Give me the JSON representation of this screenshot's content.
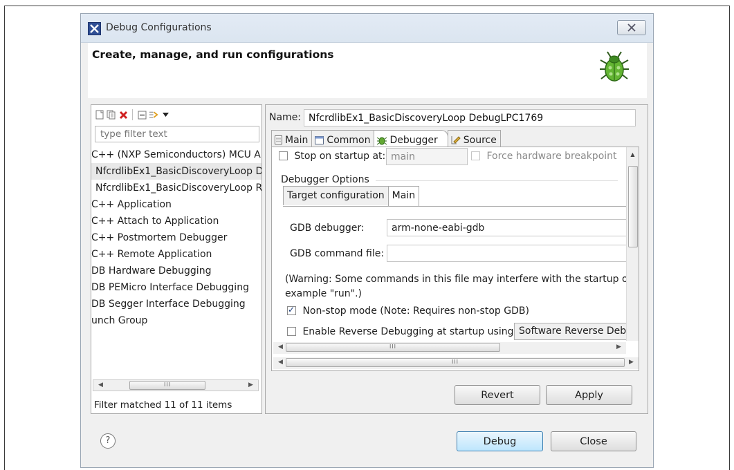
{
  "window": {
    "title": "Debug Configurations",
    "header_title": "Create, manage, and run configurations"
  },
  "left_panel": {
    "toolbar": [
      "new-config-icon",
      "duplicate-icon",
      "delete-icon",
      "collapse-all-icon",
      "filter-icon",
      "dropdown-icon"
    ],
    "filter_placeholder": "type filter text",
    "items": [
      {
        "label": "C++ (NXP Semiconductors) MCU A",
        "selected": false,
        "indent": false
      },
      {
        "label": "NfcrdlibEx1_BasicDiscoveryLoop D",
        "selected": true,
        "indent": true
      },
      {
        "label": "NfcrdlibEx1_BasicDiscoveryLoop R",
        "selected": false,
        "indent": true
      },
      {
        "label": "C++ Application",
        "selected": false,
        "indent": false
      },
      {
        "label": "C++ Attach to Application",
        "selected": false,
        "indent": false
      },
      {
        "label": "C++ Postmortem Debugger",
        "selected": false,
        "indent": false
      },
      {
        "label": "C++ Remote Application",
        "selected": false,
        "indent": false
      },
      {
        "label": "DB Hardware Debugging",
        "selected": false,
        "indent": false
      },
      {
        "label": "DB PEMicro Interface Debugging",
        "selected": false,
        "indent": false
      },
      {
        "label": "DB Segger Interface Debugging",
        "selected": false,
        "indent": false
      },
      {
        "label": "unch Group",
        "selected": false,
        "indent": false
      }
    ],
    "scroll_thumb": "III",
    "filter_status": "Filter matched 11 of 11 items"
  },
  "right_panel": {
    "name_label": "Name:",
    "name_value": "NfcrdlibEx1_BasicDiscoveryLoop DebugLPC1769",
    "tabs": [
      {
        "label": "Main",
        "icon": "main-tab-icon",
        "active": false
      },
      {
        "label": "Common",
        "icon": "common-tab-icon",
        "active": false
      },
      {
        "label": "Debugger",
        "icon": "debugger-tab-icon",
        "active": true
      },
      {
        "label": "Source",
        "icon": "source-tab-icon",
        "active": false
      }
    ],
    "debugger": {
      "stop_on_startup_label": "Stop on startup at:",
      "stop_on_startup_checked": false,
      "stop_on_startup_value": "main",
      "force_hw_breakpoint_label": "Force hardware breakpoint",
      "section_label": "Debugger Options",
      "inner_tabs": [
        {
          "label": "Target configuration",
          "active": false
        },
        {
          "label": "Main",
          "active": true
        }
      ],
      "gdb_debugger_label": "GDB debugger:",
      "gdb_debugger_value": "arm-none-eabi-gdb",
      "gdb_command_file_label": "GDB command file:",
      "gdb_command_file_value": "",
      "warning_line1": "(Warning: Some commands in this file may interfere with the startup op",
      "warning_line2": "example \"run\".)",
      "non_stop_label": "Non-stop mode (Note: Requires non-stop GDB)",
      "non_stop_checked": true,
      "reverse_label": "Enable Reverse Debugging at startup using:",
      "reverse_checked": false,
      "reverse_select": "Software Reverse Debu"
    },
    "inner_scroll_thumb": "III",
    "outer_scroll_thumb": "III",
    "revert_label": "Revert",
    "apply_label": "Apply"
  },
  "footer": {
    "help_glyph": "?",
    "debug_label": "Debug",
    "close_label": "Close"
  }
}
